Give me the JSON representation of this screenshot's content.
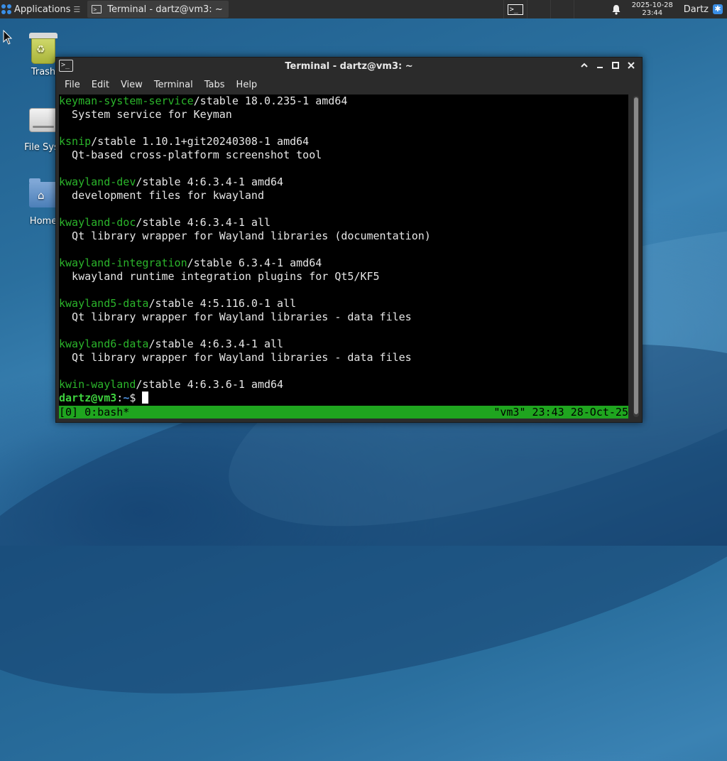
{
  "panel": {
    "applications_label": "Applications",
    "task_title": "Terminal - dartz@vm3: ~",
    "clock_date": "2025-10-28",
    "clock_time": "23:44",
    "user": "Dartz"
  },
  "desktop": {
    "icons": [
      {
        "label": "Trash"
      },
      {
        "label": "File Syst"
      },
      {
        "label": "Home"
      }
    ]
  },
  "window": {
    "title": "Terminal - dartz@vm3: ~",
    "menu": [
      "File",
      "Edit",
      "View",
      "Terminal",
      "Tabs",
      "Help"
    ]
  },
  "terminal": {
    "entries": [
      {
        "pkg": "keyman-system-service",
        "rest": "/stable 18.0.235-1 amd64",
        "desc": "  System service for Keyman"
      },
      {
        "pkg": "ksnip",
        "rest": "/stable 1.10.1+git20240308-1 amd64",
        "desc": "  Qt-based cross-platform screenshot tool"
      },
      {
        "pkg": "kwayland-dev",
        "rest": "/stable 4:6.3.4-1 amd64",
        "desc": "  development files for kwayland"
      },
      {
        "pkg": "kwayland-doc",
        "rest": "/stable 4:6.3.4-1 all",
        "desc": "  Qt library wrapper for Wayland libraries (documentation)"
      },
      {
        "pkg": "kwayland-integration",
        "rest": "/stable 6.3.4-1 amd64",
        "desc": "  kwayland runtime integration plugins for Qt5/KF5"
      },
      {
        "pkg": "kwayland5-data",
        "rest": "/stable 4:5.116.0-1 all",
        "desc": "  Qt library wrapper for Wayland libraries - data files"
      },
      {
        "pkg": "kwayland6-data",
        "rest": "/stable 4:6.3.4-1 all",
        "desc": "  Qt library wrapper for Wayland libraries - data files"
      },
      {
        "pkg": "kwin-wayland",
        "rest": "/stable 4:6.3.6-1 amd64",
        "desc": ""
      }
    ],
    "prompt_user": "dartz@vm3",
    "prompt_colon": ":",
    "prompt_path": "~",
    "prompt_symbol": "$ ",
    "tmux_left": "[0] 0:bash*",
    "tmux_right": "\"vm3\" 23:43 28-Oct-25"
  },
  "colors": {
    "package_name": "#2bb52b",
    "tmux_status": "#1fa51f",
    "prompt_user": "#3ed13e",
    "prompt_path": "#4c90e0"
  }
}
